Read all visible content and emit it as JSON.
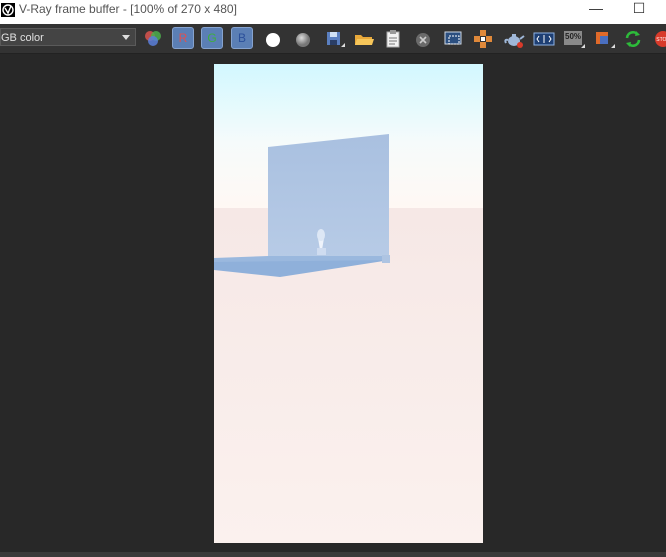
{
  "window": {
    "title": "V-Ray frame buffer - [100% of 270 x 480]",
    "minimize_glyph": "—",
    "maximize_glyph": "☐"
  },
  "toolbar": {
    "channel_value": "GB color",
    "r_label": "R",
    "g_label": "G",
    "b_label": "B",
    "zoom_label": "50%",
    "icons": [
      "rgb-channels-icon",
      "white-circle-icon",
      "grey-circle-icon",
      "save-icon",
      "open-folder-icon",
      "clipboard-icon",
      "clear-icon",
      "region-icon",
      "track-mouse-icon",
      "teapot-render-icon",
      "compare-icon",
      "zoom-50-icon",
      "color-correction-icon",
      "refresh-icon",
      "stop-icon"
    ]
  },
  "colors": {
    "accent_blue": "#5b7fb5",
    "stop_red": "#d83a2a",
    "refresh_green": "#2dbb3a",
    "sky_top": "#d2f8ff",
    "ground": "#faf0ee"
  }
}
